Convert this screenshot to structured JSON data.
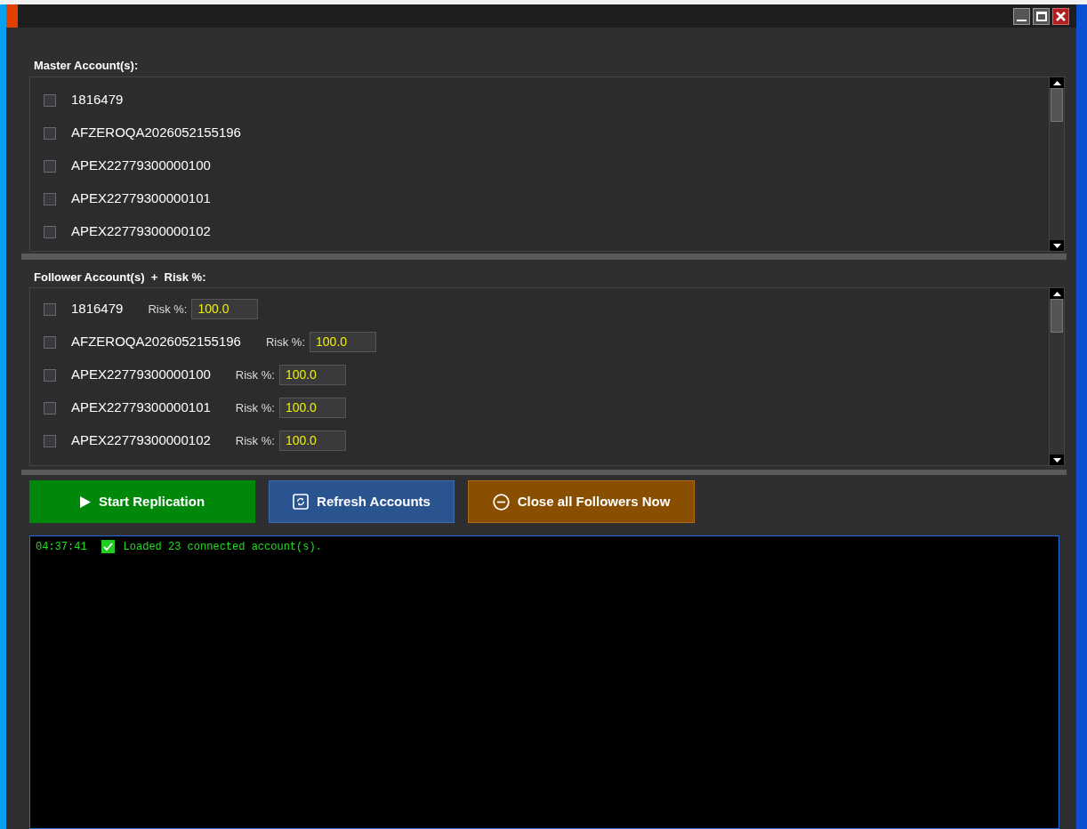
{
  "master": {
    "label": "Master Account(s):",
    "accounts": [
      {
        "name": "1816479",
        "checked": false
      },
      {
        "name": "AFZEROQA2026052155196",
        "checked": false
      },
      {
        "name": "APEX22779300000100",
        "checked": false
      },
      {
        "name": "APEX22779300000101",
        "checked": false
      },
      {
        "name": "APEX22779300000102",
        "checked": false
      }
    ]
  },
  "follower": {
    "label": "Follower Account(s)  +  Risk %:",
    "accounts": [
      {
        "name": "1816479",
        "checked": false,
        "risk_label": "Risk %:",
        "risk": "100.0"
      },
      {
        "name": "AFZEROQA2026052155196",
        "checked": false,
        "risk_label": "Risk %:",
        "risk": "100.0"
      },
      {
        "name": "APEX22779300000100",
        "checked": false,
        "risk_label": "Risk %:",
        "risk": "100.0"
      },
      {
        "name": "APEX22779300000101",
        "checked": false,
        "risk_label": "Risk %:",
        "risk": "100.0"
      },
      {
        "name": "APEX22779300000102",
        "checked": false,
        "risk_label": "Risk %:",
        "risk": "100.0"
      }
    ]
  },
  "buttons": [
    {
      "kind": "start",
      "label": "Start Replication"
    },
    {
      "kind": "refresh",
      "label": "Refresh Accounts"
    },
    {
      "kind": "close",
      "label": "Close all Followers Now"
    }
  ],
  "log": [
    {
      "time": "04:37:41",
      "kind": "success",
      "message": "Loaded 23 connected account(s)."
    }
  ]
}
